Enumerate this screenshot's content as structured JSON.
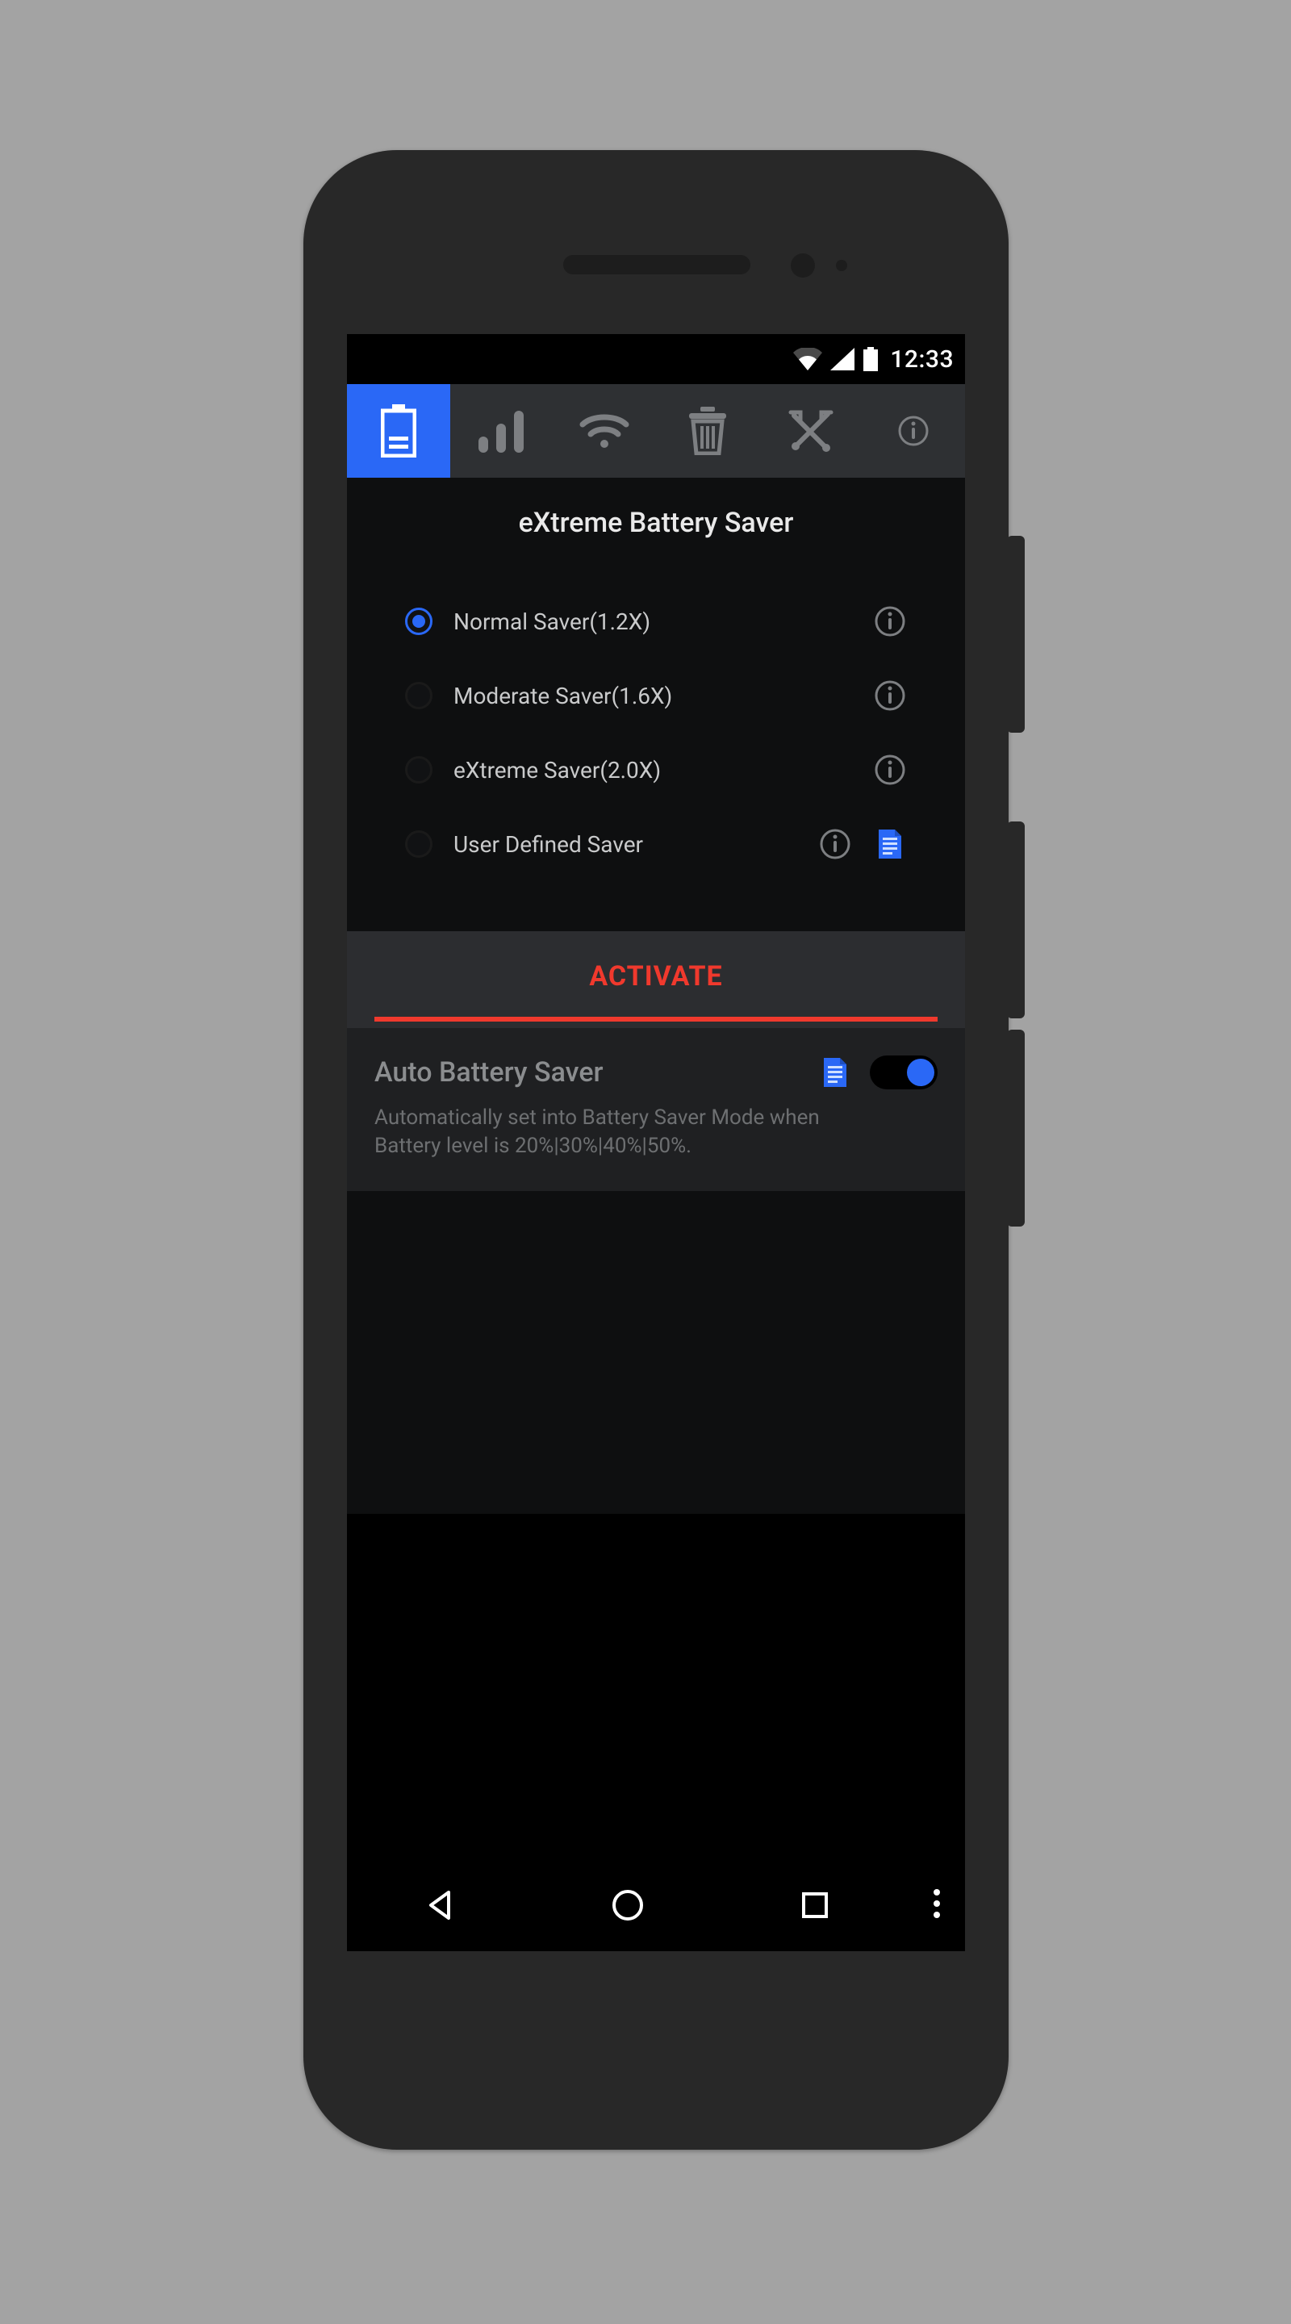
{
  "statusbar": {
    "time": "12:33"
  },
  "page_title": "eXtreme Battery Saver",
  "options": [
    {
      "label": "Normal Saver(1.2X)",
      "selected": true,
      "has_doc": false
    },
    {
      "label": "Moderate Saver(1.6X)",
      "selected": false,
      "has_doc": false
    },
    {
      "label": "eXtreme Saver(2.0X)",
      "selected": false,
      "has_doc": false
    },
    {
      "label": "User Defined Saver",
      "selected": false,
      "has_doc": true
    }
  ],
  "activate_label": "ACTIVATE",
  "auto_saver": {
    "title": "Auto Battery Saver",
    "description": "Automatically set into Battery Saver Mode when Battery level is 20%|30%|40%|50%.",
    "enabled": true
  },
  "colors": {
    "accent": "#2a68f6",
    "danger": "#f0392d"
  }
}
